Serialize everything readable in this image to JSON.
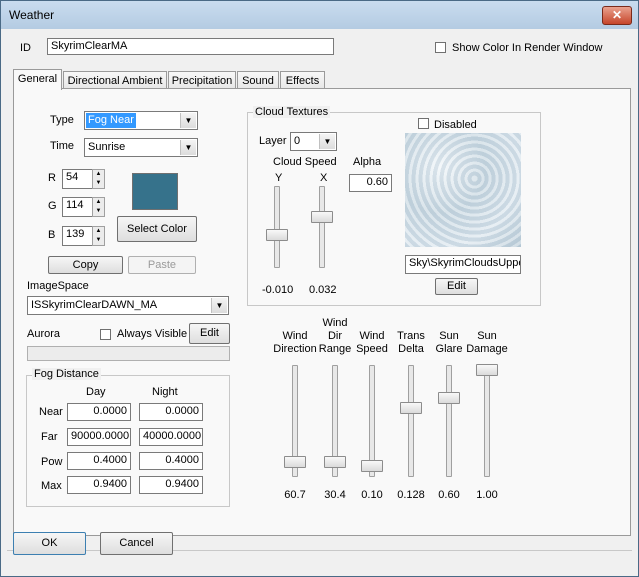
{
  "window": {
    "title": "Weather",
    "close_glyph": "✕"
  },
  "header": {
    "id_label": "ID",
    "id_value": "SkyrimClearMA",
    "show_color_label": "Show Color In Render Window",
    "show_color_checked": false
  },
  "tabs": [
    {
      "label": "General",
      "active": true
    },
    {
      "label": "Directional Ambient",
      "active": false
    },
    {
      "label": "Precipitation",
      "active": false
    },
    {
      "label": "Sound",
      "active": false
    },
    {
      "label": "Effects",
      "active": false
    }
  ],
  "general": {
    "type_label": "Type",
    "type_value": "Fog Near",
    "time_label": "Time",
    "time_value": "Sunrise",
    "r_label": "R",
    "r_value": "54",
    "g_label": "G",
    "g_value": "114",
    "b_label": "B",
    "b_value": "139",
    "color_swatch": "#36728b",
    "select_color_label": "Select Color",
    "copy_label": "Copy",
    "paste_label": "Paste",
    "imagespace_label": "ImageSpace",
    "imagespace_value": "ISSkyrimClearDAWN_MA",
    "aurora_label": "Aurora",
    "always_visible_label": "Always Visible",
    "aurora_edit_label": "Edit"
  },
  "fog_distance": {
    "title": "Fog Distance",
    "day_header": "Day",
    "night_header": "Night",
    "rows": [
      {
        "label": "Near",
        "day": "0.0000",
        "night": "0.0000"
      },
      {
        "label": "Far",
        "day": "90000.0000",
        "night": "40000.0000"
      },
      {
        "label": "Pow",
        "day": "0.4000",
        "night": "0.4000"
      },
      {
        "label": "Max",
        "day": "0.9400",
        "night": "0.9400"
      }
    ]
  },
  "cloud": {
    "title": "Cloud Textures",
    "disabled_label": "Disabled",
    "layer_label": "Layer",
    "layer_value": "0",
    "cloud_speed_label": "Cloud Speed",
    "y_label": "Y",
    "x_label": "X",
    "alpha_label": "Alpha",
    "alpha_value": "0.60",
    "y_value": "-0.010",
    "x_value": "0.032",
    "texture_path": "Sky\\SkyrimCloudsUpper",
    "edit_label": "Edit"
  },
  "sliders": [
    {
      "line1": "",
      "line2": "Wind",
      "line3": "Direction",
      "value": "60.7",
      "level": 0.08
    },
    {
      "line1": "Wind",
      "line2": "Dir",
      "line3": "Range",
      "value": "30.4",
      "level": 0.08
    },
    {
      "line1": "",
      "line2": "Wind",
      "line3": "Speed",
      "value": "0.10",
      "level": 0.04
    },
    {
      "line1": "",
      "line2": "Trans",
      "line3": "Delta",
      "value": "0.128",
      "level": 0.62
    },
    {
      "line1": "",
      "line2": "Sun",
      "line3": "Glare",
      "value": "0.60",
      "level": 0.72
    },
    {
      "line1": "",
      "line2": "Sun",
      "line3": "Damage",
      "value": "1.00",
      "level": 1.0
    }
  ],
  "footer": {
    "ok_label": "OK",
    "cancel_label": "Cancel"
  }
}
